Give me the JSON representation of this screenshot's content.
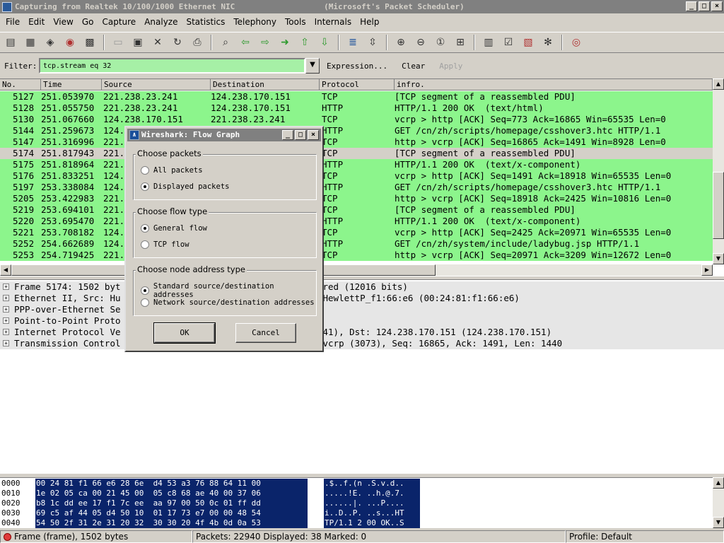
{
  "window": {
    "title": "Capturing from Realtek 10/100/1000 Ethernet NIC                   (Microsoft's Packet Scheduler)",
    "buttons": [
      "_",
      "□",
      "×"
    ]
  },
  "menu": [
    "File",
    "Edit",
    "View",
    "Go",
    "Capture",
    "Analyze",
    "Statistics",
    "Telephony",
    "Tools",
    "Internals",
    "Help"
  ],
  "filter": {
    "label": "Filter:",
    "value": "tcp.stream eq 32",
    "expression": "Expression...",
    "clear": "Clear",
    "apply": "Apply"
  },
  "packet_list": {
    "columns": [
      "No.",
      "Time",
      "Source",
      "Destination",
      "Protocol",
      "infro."
    ],
    "rows": [
      [
        "5127",
        "251.053970",
        "221.238.23.241",
        "124.238.170.151",
        "TCP",
        "[TCP segment of a reassembled PDU]"
      ],
      [
        "5128",
        "251.055750",
        "221.238.23.241",
        "124.238.170.151",
        "HTTP",
        "HTTP/1.1 200 OK  (text/html)"
      ],
      [
        "5130",
        "251.067660",
        "124.238.170.151",
        "221.238.23.241",
        "TCP",
        "vcrp > http [ACK] Seq=773 Ack=16865 Win=65535 Len=0"
      ],
      [
        "5144",
        "251.259673",
        "124.",
        "",
        "HTTP",
        "GET /cn/zh/scripts/homepage/csshover3.htc HTTP/1.1"
      ],
      [
        "5147",
        "251.316996",
        "221.",
        "",
        "TCP",
        "http > vcrp [ACK] Seq=16865 Ack=1491 Win=8928 Len=0"
      ],
      [
        "5174",
        "251.817943",
        "221.",
        "",
        "TCP",
        "[TCP segment of a reassembled PDU]"
      ],
      [
        "5175",
        "251.818964",
        "221.",
        "",
        "HTTP",
        "HTTP/1.1 200 OK  (text/x-component)"
      ],
      [
        "5176",
        "251.833251",
        "124.",
        "",
        "TCP",
        "vcrp > http [ACK] Seq=1491 Ack=18918 Win=65535 Len=0"
      ],
      [
        "5197",
        "253.338084",
        "124.",
        "",
        "HTTP",
        "GET /cn/zh/scripts/homepage/csshover3.htc HTTP/1.1"
      ],
      [
        "5205",
        "253.422983",
        "221.",
        "",
        "TCP",
        "http > vcrp [ACK] Seq=18918 Ack=2425 Win=10816 Len=0"
      ],
      [
        "5219",
        "253.694101",
        "221.",
        "",
        "TCP",
        "[TCP segment of a reassembled PDU]"
      ],
      [
        "5220",
        "253.695470",
        "221.",
        "",
        "HTTP",
        "HTTP/1.1 200 OK  (text/x-component)"
      ],
      [
        "5221",
        "253.708182",
        "124.",
        "",
        "TCP",
        "vcrp > http [ACK] Seq=2425 Ack=20971 Win=65535 Len=0"
      ],
      [
        "5252",
        "254.662689",
        "124.",
        "",
        "HTTP",
        "GET /cn/zh/system/include/ladybug.jsp HTTP/1.1"
      ],
      [
        "5253",
        "254.719425",
        "221.",
        "",
        "TCP",
        "http > vcrp [ACK] Seq=20971 Ack=3209 Win=12672 Len=0"
      ]
    ],
    "selected_index": 5
  },
  "details": [
    "Frame 5174: 1502 byt                                 captured (12016 bits)",
    "Ethernet II, Src: Hu                               , Dst: HewlettP_f1:66:e6 (00:24:81:f1:66:e6)",
    "PPP-over-Ethernet Se",
    "Point-to-Point Proto",
    "Internet Protocol Ve                               38.23.241), Dst: 124.238.170.151 (124.238.170.151)",
    "Transmission Control                                Port: vcrp (3073), Seq: 16865, Ack: 1491, Len: 1440"
  ],
  "hex": [
    {
      "off": "0000",
      "bytes": "00 24 81 f1 66 e6 28 6e  d4 53 a3 76 88 64 11 00",
      "ascii": ".$..f.(n .S.v.d.."
    },
    {
      "off": "0010",
      "bytes": "1e 02 05 ca 00 21 45 00  05 c8 68 ae 40 00 37 06",
      "ascii": ".....!E. ..h.@.7."
    },
    {
      "off": "0020",
      "bytes": "b8 1c dd ee 17 f1 7c ee  aa 97 00 50 0c 01 ff dd",
      "ascii": "......|. ...P...."
    },
    {
      "off": "0030",
      "bytes": "69 c5 af 44 05 d4 50 10  01 17 73 e7 00 00 48 54",
      "ascii": "i..D..P. ..s...HT"
    },
    {
      "off": "0040",
      "bytes": "54 50 2f 31 2e 31 20 32  30 30 20 4f 4b 0d 0a 53",
      "ascii": "TP/1.1 2 00 OK..S"
    }
  ],
  "status": {
    "frame": "Frame (frame), 1502 bytes",
    "packets": "Packets: 22940 Displayed: 38 Marked: 0",
    "profile": "Profile: Default"
  },
  "dialog": {
    "title": "Wireshark: Flow Graph",
    "group1_label": "Choose packets",
    "g1_opt1": "All packets",
    "g1_opt2": "Displayed packets",
    "group2_label": "Choose flow type",
    "g2_opt1": "General flow",
    "g2_opt2": "TCP flow",
    "group3_label": "Choose node address type",
    "g3_opt1": "Standard source/destination addresses",
    "g3_opt2": "Network source/destination addresses",
    "ok": "OK",
    "cancel": "Cancel"
  },
  "colors": {
    "tcp_green": "#8cf58c",
    "filter_valid": "#a6f0a6",
    "selection": "#0a246a"
  }
}
